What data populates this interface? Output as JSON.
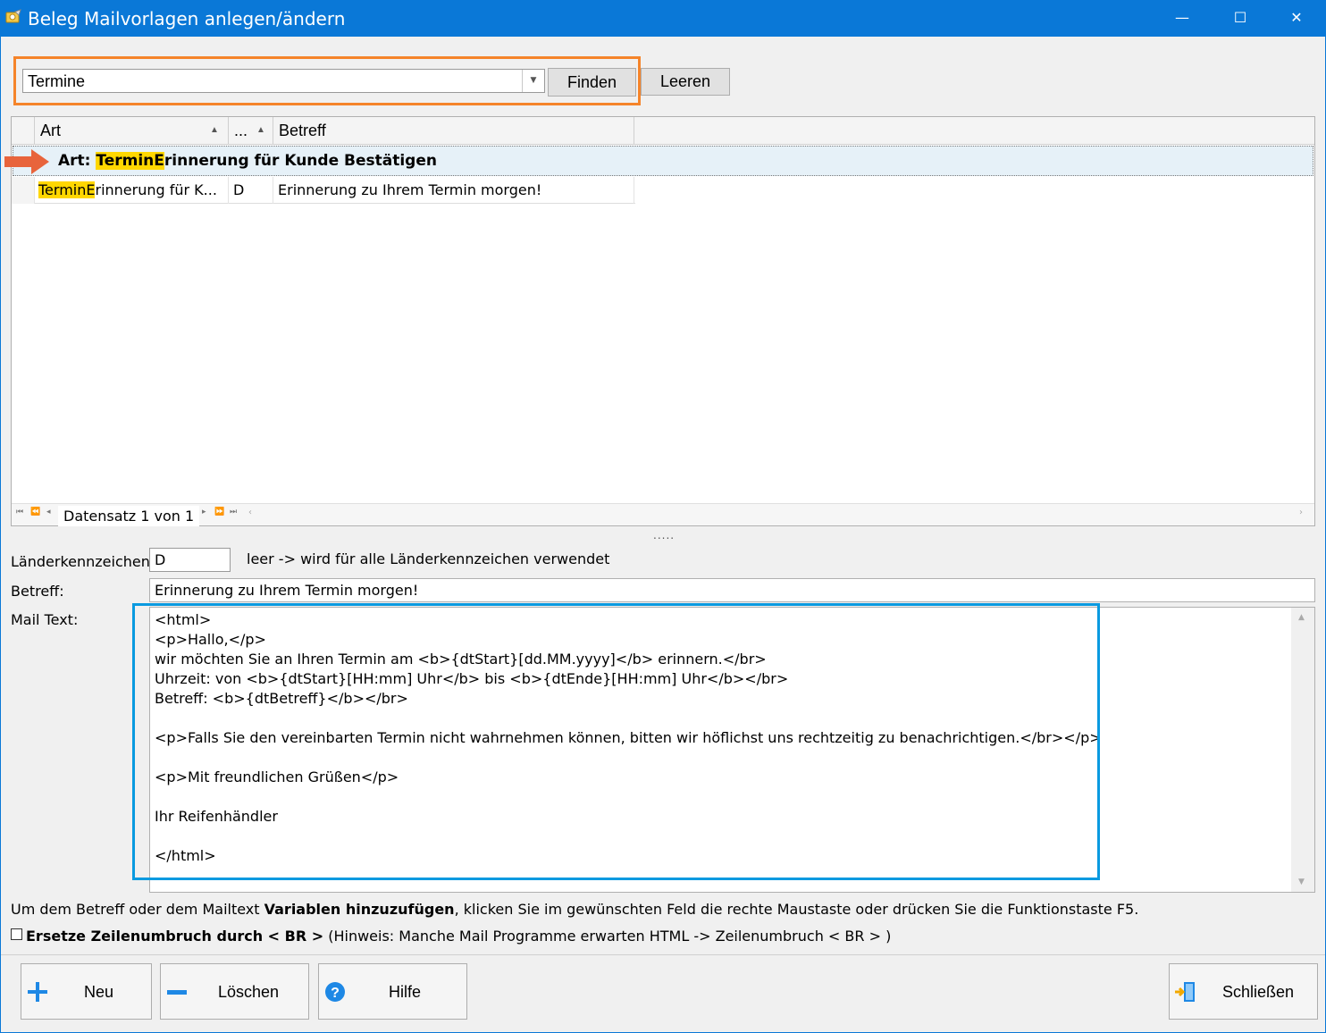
{
  "window": {
    "title": "Beleg Mailvorlagen anlegen/ändern",
    "controls": {
      "minimize": "—",
      "maximize": "☐",
      "close": "✕"
    }
  },
  "search": {
    "value": "Termine",
    "find_label": "Finden",
    "clear_label": "Leeren"
  },
  "grid": {
    "columns": [
      {
        "label": "Art",
        "sort": "ascending"
      },
      {
        "label": "...",
        "sort": "ascending"
      },
      {
        "label": "Betreff"
      }
    ],
    "group": {
      "prefix": "Art: ",
      "highlight": "TerminE",
      "rest": "rinnerung für Kunde Bestätigen"
    },
    "rows": [
      {
        "art_highlight": "TerminE",
        "art_rest": "rinnerung für K...",
        "land": "D",
        "betreff": "Erinnerung zu Ihrem Termin morgen!"
      }
    ],
    "navigator": {
      "text": "Datensatz 1 von 1"
    }
  },
  "form": {
    "land_label": "Länderkennzeichen",
    "land_value": "D",
    "land_hint": "leer -> wird für alle Länderkennzeichen verwendet",
    "betreff_label": "Betreff:",
    "betreff_value": "Erinnerung zu Ihrem Termin morgen!",
    "mail_label": "Mail Text:",
    "mail_lines": [
      "<html>",
      "<p>Hallo,</p>",
      "wir möchten Sie an Ihren Termin am <b>{dtStart}[dd.MM.yyyy]</b> erinnern.</br>",
      "Uhrzeit: von <b>{dtStart}[HH:mm] Uhr</b> bis <b>{dtEnde}[HH:mm] Uhr</b></br>",
      "Betreff: <b>{dtBetreff}</b></br>",
      "",
      "<p>Falls Sie den vereinbarten Termin nicht wahrnehmen können, bitten wir höflichst uns rechtzeitig zu benachrichtigen.</br></p>",
      "",
      "<p>Mit freundlichen Grüßen</p>",
      "",
      "Ihr Reifenhändler",
      "",
      "</html>"
    ]
  },
  "info": {
    "part1": "Um dem Betreff oder dem Mailtext ",
    "bold": "Variablen hinzuzufügen",
    "part2": ", klicken Sie im gewünschten Feld die rechte Maustaste oder drücken Sie die Funktionstaste F5."
  },
  "option": {
    "checked": false,
    "bold": "Ersetze Zeilenumbruch durch < BR >",
    "hint": " (Hinweis: Manche Mail Programme erwarten HTML -> Zeilenumbruch <  BR > )"
  },
  "buttons": {
    "neu": "Neu",
    "loeschen": "Löschen",
    "hilfe": "Hilfe",
    "schliessen": "Schließen"
  },
  "icons": {
    "app": "mail-template-icon",
    "neu": "plus-icon",
    "loeschen": "minus-icon",
    "hilfe": "help-icon",
    "schliessen": "exit-door-icon"
  },
  "colors": {
    "titlebar": "#0a78d7",
    "search_highlight_frame": "#f5842a",
    "mail_highlight_frame": "#0a9ae0",
    "match_highlight": "#ffd700",
    "group_row": "#e6f1f8",
    "pointer_arrow": "#e8643c"
  }
}
